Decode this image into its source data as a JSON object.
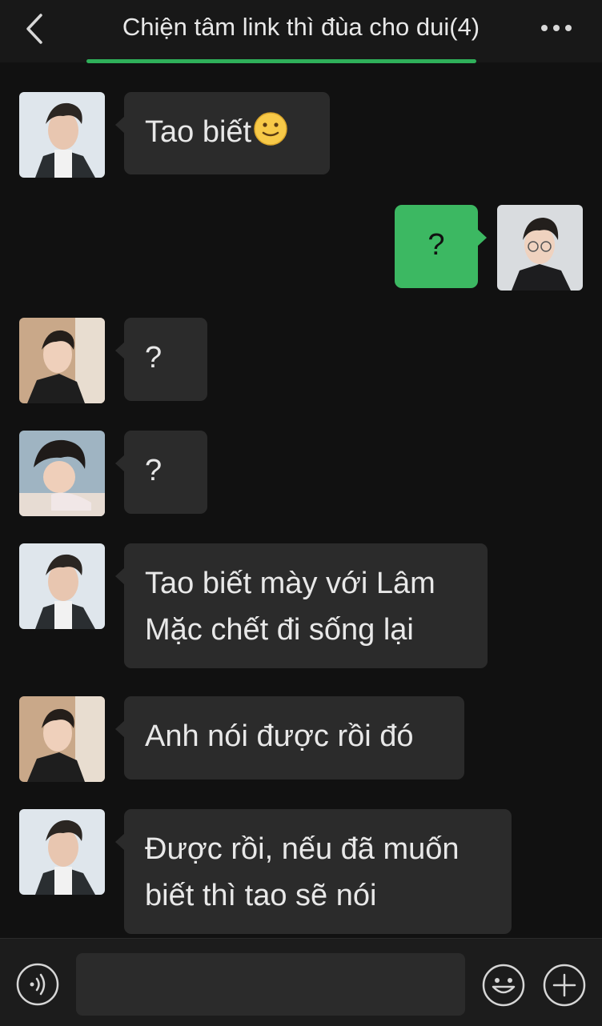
{
  "header": {
    "title": "Chiện tâm link thì đùa cho dui(4)",
    "back_icon": "chevron-left-icon",
    "more_icon": "more-dots-icon"
  },
  "colors": {
    "background": "#111111",
    "bubble_left": "#2b2b2b",
    "bubble_right": "#3cb862",
    "accent": "#2fb05a"
  },
  "messages": [
    {
      "side": "left",
      "sender": "avatar-1",
      "text": "Tao biết",
      "emoji": "slightly-smiling-face-icon"
    },
    {
      "side": "right",
      "sender": "self-avatar",
      "text": "?"
    },
    {
      "side": "left",
      "sender": "avatar-2",
      "text": "?"
    },
    {
      "side": "left",
      "sender": "avatar-3",
      "text": "?"
    },
    {
      "side": "left",
      "sender": "avatar-1",
      "lines": [
        "Tao biết mày với Lâm",
        "Mặc chết đi sống lại"
      ]
    },
    {
      "side": "left",
      "sender": "avatar-2",
      "text": "Anh nói được rồi đó"
    },
    {
      "side": "left",
      "sender": "avatar-1",
      "lines": [
        "Được rồi, nếu đã muốn",
        "biết thì tao sẽ nói"
      ]
    }
  ],
  "input_bar": {
    "voice_icon": "voice-icon",
    "input_value": "",
    "emoji_icon": "emoji-icon",
    "plus_icon": "plus-icon"
  }
}
